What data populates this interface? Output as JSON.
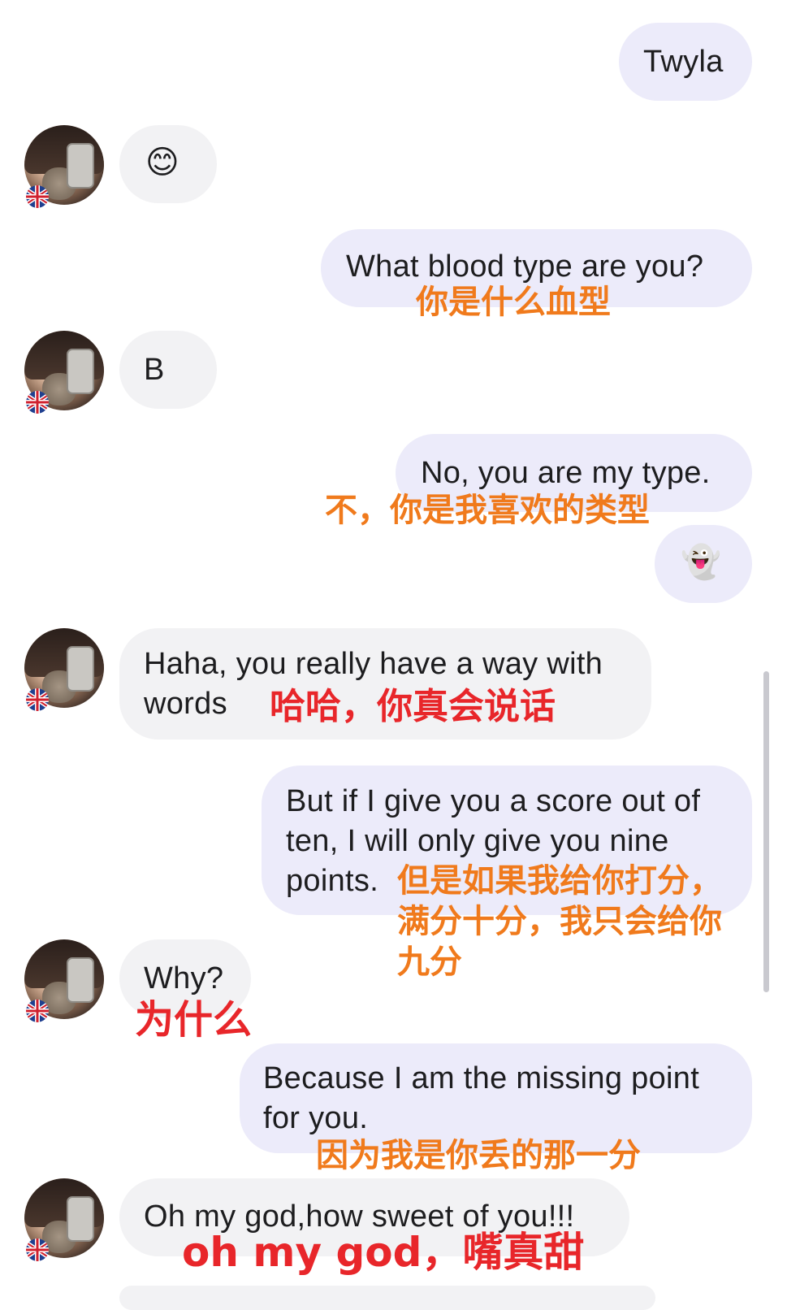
{
  "messages": {
    "m1": {
      "text": "Twyla"
    },
    "m2": {
      "emoji": "😊"
    },
    "m3": {
      "text": "What blood type are you?",
      "translation": "你是什么血型"
    },
    "m4": {
      "text": "B"
    },
    "m5": {
      "text": "No, you are my type.",
      "translation": "不，你是我喜欢的类型"
    },
    "m6": {
      "emoji": "👻"
    },
    "m7": {
      "line1": "Haha, you really have a way with",
      "line2": "words",
      "translation": "哈哈，你真会说话"
    },
    "m8": {
      "line1": "But if I give you a score out of",
      "line2": "ten, I will only give you nine",
      "line3": "points.",
      "tr1": "但是如果我给你打分，",
      "tr2": "满分十分，我只会给你",
      "tr3": "九分"
    },
    "m9": {
      "text": "Why?",
      "translation": "为什么"
    },
    "m10": {
      "line1": "Because I am the missing point",
      "line2": "for you.",
      "translation": "因为我是你丢的那一分"
    },
    "m11": {
      "text": "Oh my god,how sweet of you!!!",
      "translation": "oh my god，嘴真甜"
    }
  },
  "colors": {
    "outgoing_bubble": "#ecebfa",
    "incoming_bubble": "#f2f2f4",
    "translation_orange": "#f07a1c",
    "translation_red": "#e8262a"
  }
}
